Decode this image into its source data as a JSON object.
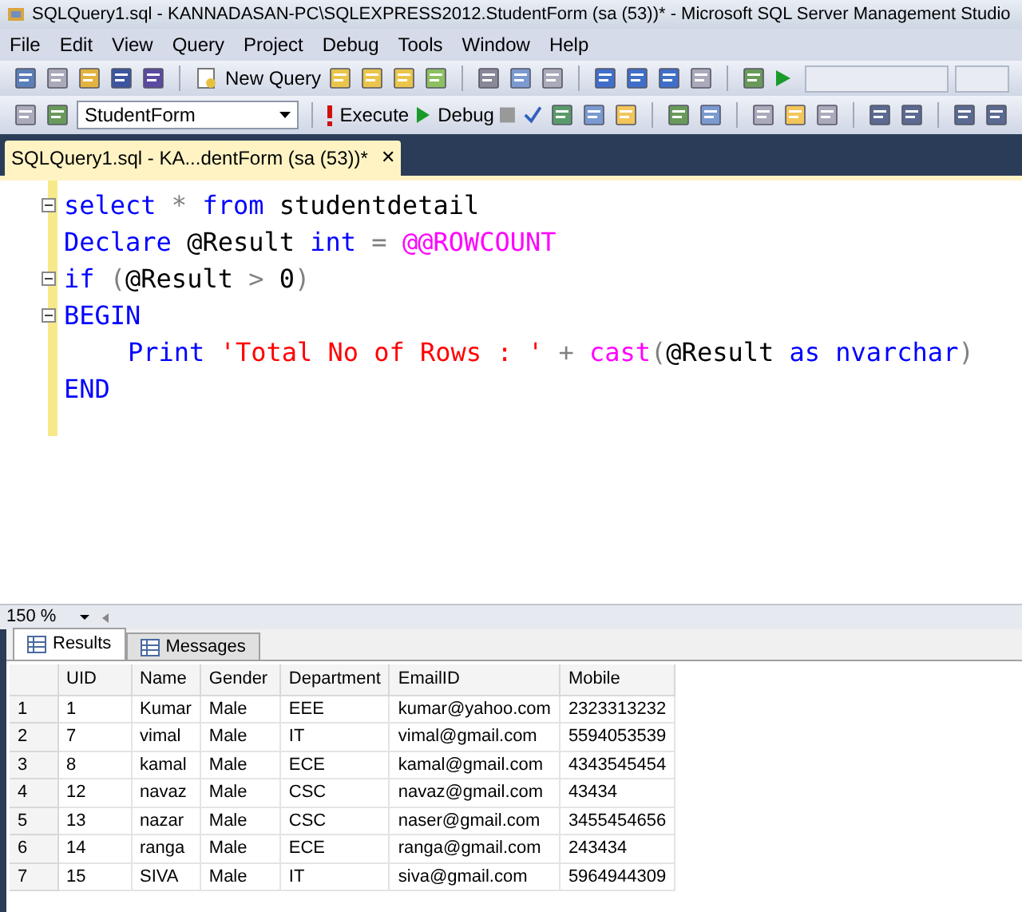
{
  "window": {
    "title": "SQLQuery1.sql - KANNADASAN-PC\\SQLEXPRESS2012.StudentForm (sa (53))* - Microsoft SQL Server Management Studio"
  },
  "menu": [
    "File",
    "Edit",
    "View",
    "Query",
    "Project",
    "Debug",
    "Tools",
    "Window",
    "Help"
  ],
  "toolbar": {
    "new_query": "New Query",
    "database": "StudentForm",
    "execute": "Execute",
    "debug": "Debug"
  },
  "document_tab": {
    "label": "SQLQuery1.sql - KA...dentForm (sa (53))*",
    "close": "✕"
  },
  "editor": {
    "lines": [
      {
        "fold": true,
        "indented": false,
        "tokens": [
          {
            "kind": "keyword",
            "text": "select"
          },
          {
            "kind": "operator",
            "text": " * "
          },
          {
            "kind": "keyword",
            "text": "from"
          },
          {
            "kind": "plain",
            "text": " studentdetail"
          }
        ]
      },
      {
        "fold": false,
        "indented": false,
        "tokens": [
          {
            "kind": "keyword",
            "text": "Declare"
          },
          {
            "kind": "plain",
            "text": " @Result "
          },
          {
            "kind": "keyword",
            "text": "int"
          },
          {
            "kind": "operator",
            "text": " = "
          },
          {
            "kind": "function",
            "text": "@@ROWCOUNT"
          }
        ]
      },
      {
        "fold": true,
        "indented": false,
        "tokens": [
          {
            "kind": "keyword",
            "text": "if"
          },
          {
            "kind": "operator",
            "text": " ("
          },
          {
            "kind": "plain",
            "text": "@Result "
          },
          {
            "kind": "operator",
            "text": ">"
          },
          {
            "kind": "plain",
            "text": " 0"
          },
          {
            "kind": "operator",
            "text": ")"
          }
        ]
      },
      {
        "fold": true,
        "indented": false,
        "tokens": [
          {
            "kind": "keyword",
            "text": "BEGIN"
          }
        ]
      },
      {
        "fold": false,
        "indented": true,
        "tokens": [
          {
            "kind": "keyword",
            "text": "Print"
          },
          {
            "kind": "string",
            "text": " 'Total No of Rows : '"
          },
          {
            "kind": "operator",
            "text": " + "
          },
          {
            "kind": "function",
            "text": "cast"
          },
          {
            "kind": "operator",
            "text": "("
          },
          {
            "kind": "plain",
            "text": "@Result "
          },
          {
            "kind": "keyword",
            "text": "as"
          },
          {
            "kind": "keyword",
            "text": " nvarchar"
          },
          {
            "kind": "operator",
            "text": ")"
          }
        ]
      },
      {
        "fold": false,
        "indented": false,
        "tokens": [
          {
            "kind": "keyword",
            "text": "END"
          }
        ]
      }
    ]
  },
  "zoom": "150 %",
  "result_tabs": [
    {
      "label": "Results",
      "selected": true
    },
    {
      "label": "Messages",
      "selected": false
    }
  ],
  "table": {
    "columns": [
      "UID",
      "Name",
      "Gender",
      "Department",
      "EmailID",
      "Mobile"
    ],
    "rows": [
      {
        "number": "1",
        "cells": [
          "1",
          "Kumar",
          "Male",
          "EEE",
          "kumar@yahoo.com",
          "2323313232"
        ]
      },
      {
        "number": "2",
        "cells": [
          "7",
          "vimal",
          "Male",
          "IT",
          "vimal@gmail.com",
          "5594053539"
        ]
      },
      {
        "number": "3",
        "cells": [
          "8",
          "kamal",
          "Male",
          "ECE",
          "kamal@gmail.com",
          "4343545454"
        ]
      },
      {
        "number": "4",
        "cells": [
          "12",
          "navaz",
          "Male",
          "CSC",
          "navaz@gmail.com",
          "43434"
        ]
      },
      {
        "number": "5",
        "cells": [
          "13",
          "nazar",
          "Male",
          "CSC",
          "naser@gmail.com",
          "3455454656"
        ]
      },
      {
        "number": "6",
        "cells": [
          "14",
          "ranga",
          "Male",
          "ECE",
          "ranga@gmail.com",
          "243434"
        ]
      },
      {
        "number": "7",
        "cells": [
          "15",
          "SIVA",
          "Male",
          "IT",
          "siva@gmail.com",
          "5964944309"
        ]
      }
    ]
  }
}
